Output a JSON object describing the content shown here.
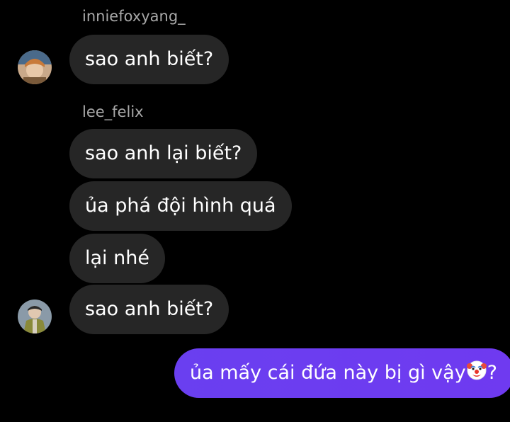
{
  "thread": {
    "group1": {
      "username": "inniefoxyang_",
      "messages": [
        "sao anh biết?"
      ]
    },
    "group2": {
      "username": "lee_felix",
      "messages": [
        "sao anh lại biết?",
        "ủa phá đội hình quá",
        "lại nhé",
        "sao anh biết?"
      ]
    },
    "outgoing": {
      "text": "ủa mấy cái đứa này bị gì vậy",
      "suffix": "?",
      "emoji_name": "clown-face-emoji"
    }
  },
  "colors": {
    "background": "#000000",
    "incoming_bubble": "#262626",
    "outgoing_bubble": "#6b3df0",
    "username_text": "#a8a8a8",
    "message_text": "#ffffff"
  }
}
